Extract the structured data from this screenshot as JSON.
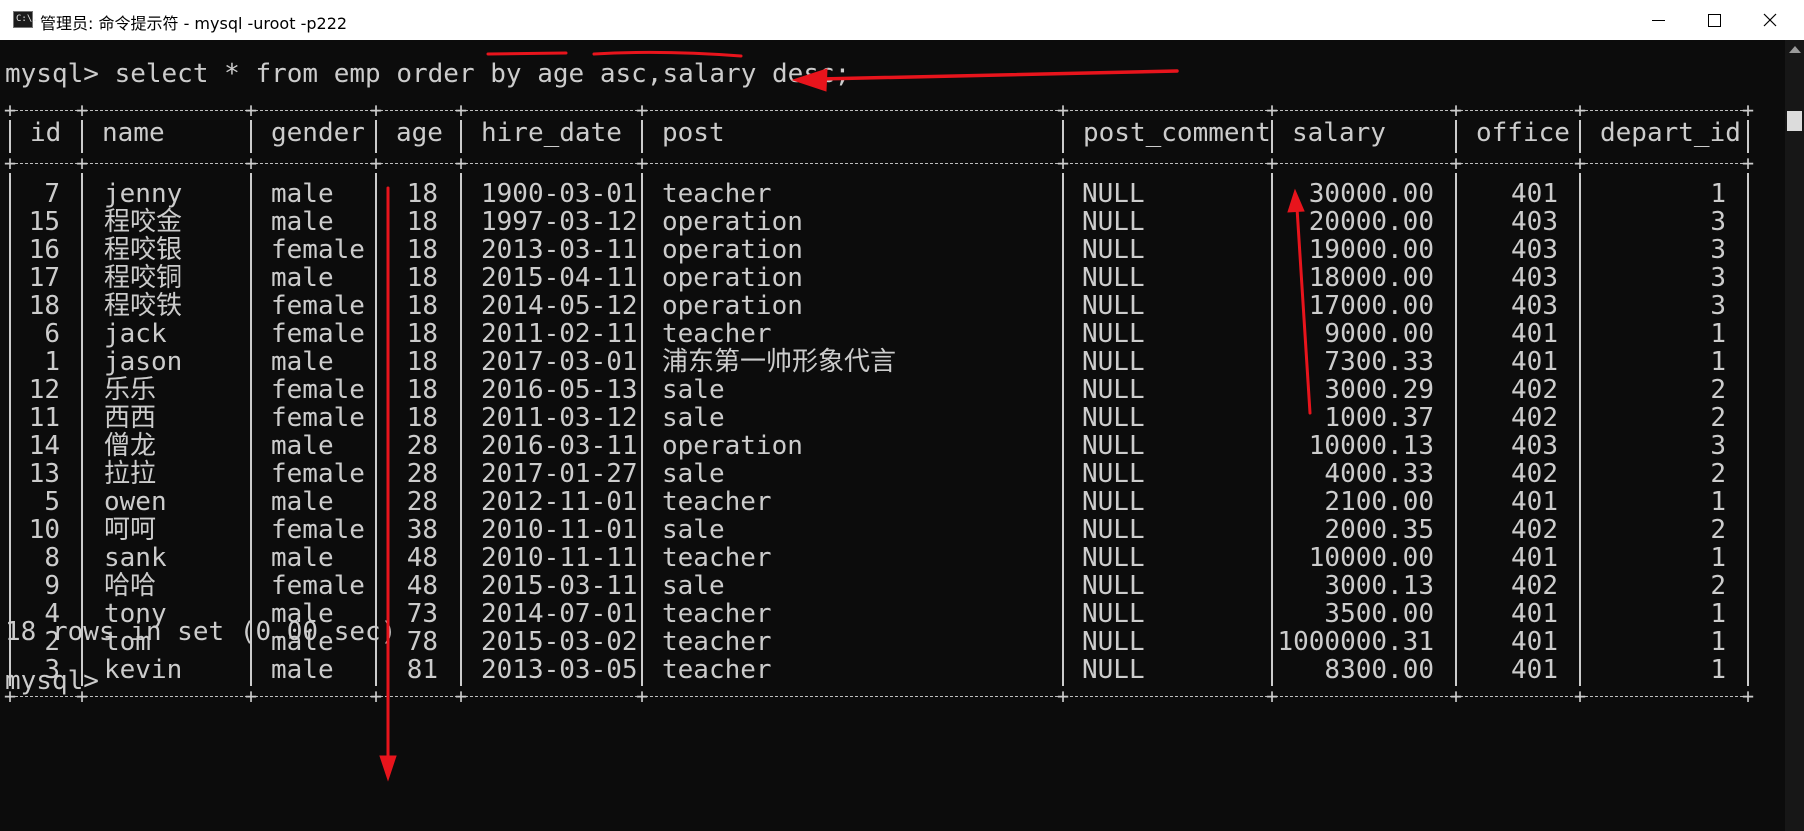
{
  "window": {
    "title": "管理员: 命令提示符 - mysql  -uroot -p222",
    "icon": "cmd-icon",
    "icon_text": "C:\\.",
    "controls": [
      "minimize-icon",
      "maximize-icon",
      "close-icon"
    ]
  },
  "terminal": {
    "prompt_command": "mysql> select * from emp order by age asc,salary desc;",
    "columns": [
      "id",
      "name",
      "gender",
      "age",
      "hire_date",
      "post",
      "post_comment",
      "salary",
      "office",
      "depart_id"
    ],
    "rows": [
      [
        "7",
        "jenny",
        "male",
        "18",
        "1900-03-01",
        "teacher",
        "NULL",
        "30000.00",
        "401",
        "1"
      ],
      [
        "15",
        "程咬金",
        "male",
        "18",
        "1997-03-12",
        "operation",
        "NULL",
        "20000.00",
        "403",
        "3"
      ],
      [
        "16",
        "程咬银",
        "female",
        "18",
        "2013-03-11",
        "operation",
        "NULL",
        "19000.00",
        "403",
        "3"
      ],
      [
        "17",
        "程咬铜",
        "male",
        "18",
        "2015-04-11",
        "operation",
        "NULL",
        "18000.00",
        "403",
        "3"
      ],
      [
        "18",
        "程咬铁",
        "female",
        "18",
        "2014-05-12",
        "operation",
        "NULL",
        "17000.00",
        "403",
        "3"
      ],
      [
        "6",
        "jack",
        "female",
        "18",
        "2011-02-11",
        "teacher",
        "NULL",
        "9000.00",
        "401",
        "1"
      ],
      [
        "1",
        "jason",
        "male",
        "18",
        "2017-03-01",
        "浦东第一帅形象代言",
        "NULL",
        "7300.33",
        "401",
        "1"
      ],
      [
        "12",
        "乐乐",
        "female",
        "18",
        "2016-05-13",
        "sale",
        "NULL",
        "3000.29",
        "402",
        "2"
      ],
      [
        "11",
        "西西",
        "female",
        "18",
        "2011-03-12",
        "sale",
        "NULL",
        "1000.37",
        "402",
        "2"
      ],
      [
        "14",
        "僧龙",
        "male",
        "28",
        "2016-03-11",
        "operation",
        "NULL",
        "10000.13",
        "403",
        "3"
      ],
      [
        "13",
        "拉拉",
        "female",
        "28",
        "2017-01-27",
        "sale",
        "NULL",
        "4000.33",
        "402",
        "2"
      ],
      [
        "5",
        "owen",
        "male",
        "28",
        "2012-11-01",
        "teacher",
        "NULL",
        "2100.00",
        "401",
        "1"
      ],
      [
        "10",
        "呵呵",
        "female",
        "38",
        "2010-11-01",
        "sale",
        "NULL",
        "2000.35",
        "402",
        "2"
      ],
      [
        "8",
        "sank",
        "male",
        "48",
        "2010-11-11",
        "teacher",
        "NULL",
        "10000.00",
        "401",
        "1"
      ],
      [
        "9",
        "哈哈",
        "female",
        "48",
        "2015-03-11",
        "sale",
        "NULL",
        "3000.13",
        "402",
        "2"
      ],
      [
        "4",
        "tony",
        "male",
        "73",
        "2014-07-01",
        "teacher",
        "NULL",
        "3500.00",
        "401",
        "1"
      ],
      [
        "2",
        "tom",
        "male",
        "78",
        "2015-03-02",
        "teacher",
        "NULL",
        "1000000.31",
        "401",
        "1"
      ],
      [
        "3",
        "kevin",
        "male",
        "81",
        "2013-03-05",
        "teacher",
        "NULL",
        "8300.00",
        "401",
        "1"
      ]
    ],
    "result_summary": "18 rows in set (0.00 sec)",
    "final_prompt": "mysql>"
  },
  "colors": {
    "terminal_bg": "#0c0c0c",
    "terminal_text": "#cccccc",
    "annotation": "#e8141c",
    "titlebar_bg": "#ffffff"
  }
}
